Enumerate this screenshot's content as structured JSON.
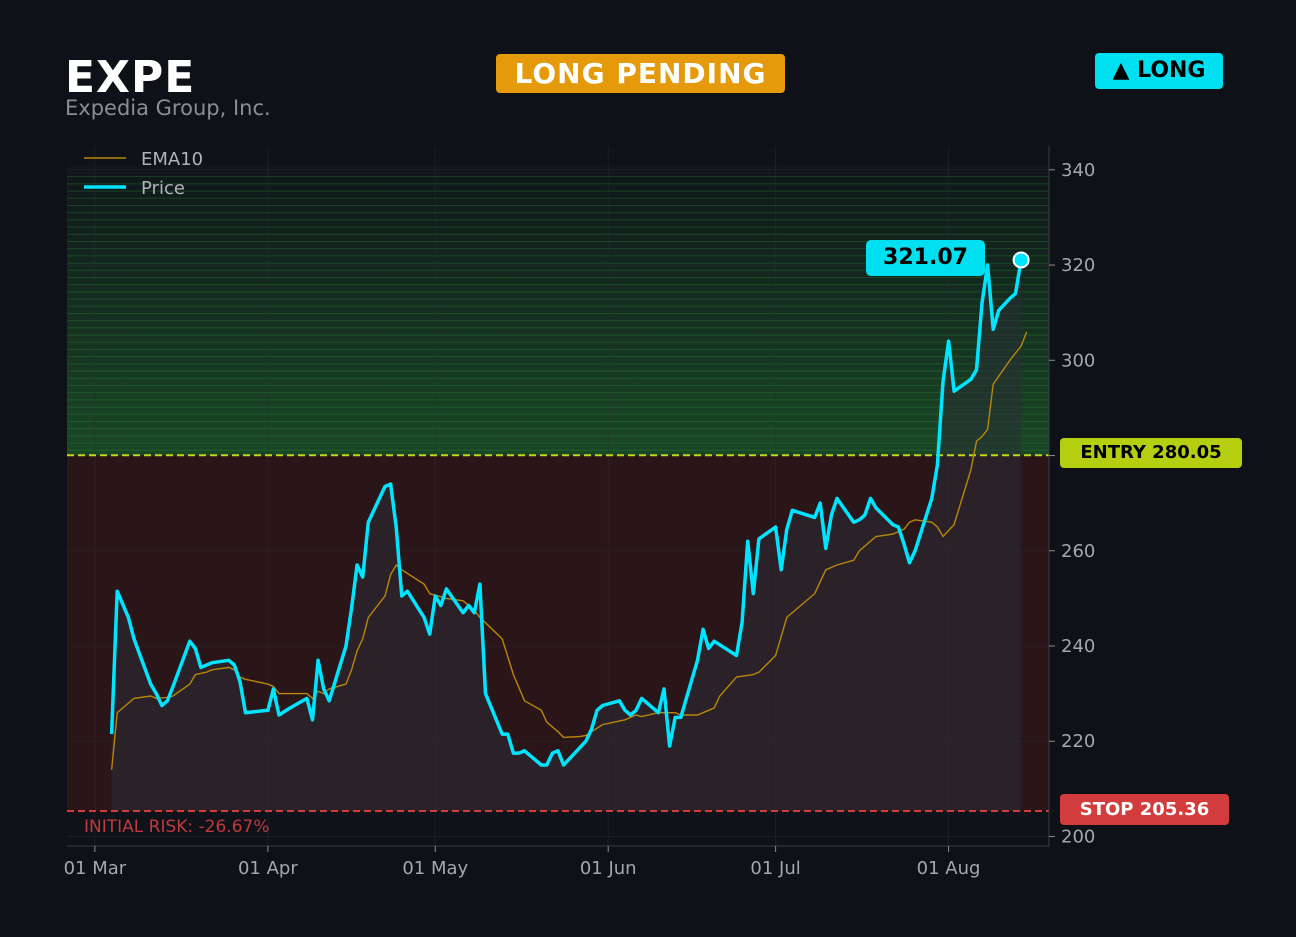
{
  "header": {
    "ticker": "EXPE",
    "company": "Expedia Group, Inc.",
    "status": "LONG PENDING",
    "direction": "▲ LONG"
  },
  "colors": {
    "background": "#0e1118",
    "price": "#00e5ff",
    "ema": "#b8860b",
    "entry": "#c4d61a",
    "stop": "#d23c3c",
    "status_badge": "#e59a0b",
    "profit_zone": "#1d5a2a",
    "risk_zone": "#2a1519"
  },
  "labels": {
    "last_price": "321.07",
    "entry": "ENTRY 280.05",
    "stop": "STOP 205.36",
    "initial_risk": "INITIAL RISK: -26.67%"
  },
  "chart_data": {
    "type": "line",
    "ylim": [
      198,
      345
    ],
    "yticks": [
      200,
      220,
      240,
      260,
      280,
      300,
      320,
      340
    ],
    "xticks": [
      {
        "date": "2024-03-01",
        "label": "01 Mar"
      },
      {
        "date": "2024-04-01",
        "label": "01 Apr"
      },
      {
        "date": "2024-05-01",
        "label": "01 May"
      },
      {
        "date": "2024-06-01",
        "label": "01 Jun"
      },
      {
        "date": "2024-07-01",
        "label": "01 Jul"
      },
      {
        "date": "2024-08-01",
        "label": "01 Aug"
      }
    ],
    "xlim": [
      "2024-02-25",
      "2024-08-19"
    ],
    "entry": 280.05,
    "stop": 205.36,
    "last_price": 321.07,
    "legend_position": "top-left",
    "grid": true,
    "series": [
      {
        "name": "EMA10",
        "points": [
          [
            "2024-03-04",
            214.0
          ],
          [
            "2024-03-05",
            226.0
          ],
          [
            "2024-03-07",
            228.0
          ],
          [
            "2024-03-08",
            229.0
          ],
          [
            "2024-03-11",
            229.5
          ],
          [
            "2024-03-12",
            229.0
          ],
          [
            "2024-03-14",
            229.2
          ],
          [
            "2024-03-15",
            229.5
          ],
          [
            "2024-03-18",
            232.0
          ],
          [
            "2024-03-19",
            234.0
          ],
          [
            "2024-03-21",
            234.5
          ],
          [
            "2024-03-22",
            235.0
          ],
          [
            "2024-03-25",
            235.5
          ],
          [
            "2024-03-26",
            235.0
          ],
          [
            "2024-03-27",
            233.5
          ],
          [
            "2024-03-28",
            233.0
          ],
          [
            "2024-04-01",
            232.0
          ],
          [
            "2024-04-02",
            231.5
          ],
          [
            "2024-04-03",
            230.0
          ],
          [
            "2024-04-08",
            230.0
          ],
          [
            "2024-04-09",
            229.0
          ],
          [
            "2024-04-10",
            230.5
          ],
          [
            "2024-04-11",
            230.0
          ],
          [
            "2024-04-12",
            231.0
          ],
          [
            "2024-04-15",
            232.0
          ],
          [
            "2024-04-16",
            235.0
          ],
          [
            "2024-04-17",
            239.0
          ],
          [
            "2024-04-18",
            241.5
          ],
          [
            "2024-04-19",
            246.0
          ],
          [
            "2024-04-22",
            250.5
          ],
          [
            "2024-04-23",
            255.0
          ],
          [
            "2024-04-24",
            257.0
          ],
          [
            "2024-04-25",
            256.0
          ],
          [
            "2024-04-29",
            253.0
          ],
          [
            "2024-04-30",
            251.0
          ],
          [
            "2024-05-03",
            250.0
          ],
          [
            "2024-05-06",
            249.5
          ],
          [
            "2024-05-07",
            248.5
          ],
          [
            "2024-05-08",
            247.5
          ],
          [
            "2024-05-09",
            246.0
          ],
          [
            "2024-05-13",
            241.5
          ],
          [
            "2024-05-15",
            234.0
          ],
          [
            "2024-05-17",
            228.5
          ],
          [
            "2024-05-20",
            226.5
          ],
          [
            "2024-05-21",
            224.0
          ],
          [
            "2024-05-23",
            222.0
          ],
          [
            "2024-05-24",
            220.8
          ],
          [
            "2024-05-27",
            221.0
          ],
          [
            "2024-05-28",
            221.2
          ],
          [
            "2024-05-29",
            222.0
          ],
          [
            "2024-05-31",
            223.5
          ],
          [
            "2024-06-04",
            224.5
          ],
          [
            "2024-06-05",
            225.0
          ],
          [
            "2024-06-06",
            225.5
          ],
          [
            "2024-06-07",
            225.2
          ],
          [
            "2024-06-10",
            226.0
          ],
          [
            "2024-06-13",
            226.0
          ],
          [
            "2024-06-14",
            225.5
          ],
          [
            "2024-06-17",
            225.5
          ],
          [
            "2024-06-18",
            226.0
          ],
          [
            "2024-06-20",
            227.0
          ],
          [
            "2024-06-21",
            229.5
          ],
          [
            "2024-06-24",
            233.5
          ],
          [
            "2024-06-27",
            234.0
          ],
          [
            "2024-06-28",
            234.5
          ],
          [
            "2024-07-01",
            238.0
          ],
          [
            "2024-07-02",
            242.0
          ],
          [
            "2024-07-03",
            246.0
          ],
          [
            "2024-07-05",
            248.0
          ],
          [
            "2024-07-08",
            251.0
          ],
          [
            "2024-07-10",
            256.0
          ],
          [
            "2024-07-12",
            257.0
          ],
          [
            "2024-07-15",
            258.0
          ],
          [
            "2024-07-16",
            260.0
          ],
          [
            "2024-07-18",
            262.0
          ],
          [
            "2024-07-19",
            263.0
          ],
          [
            "2024-07-22",
            263.5
          ],
          [
            "2024-07-24",
            264.5
          ],
          [
            "2024-07-25",
            266.0
          ],
          [
            "2024-07-26",
            266.5
          ],
          [
            "2024-07-29",
            266.0
          ],
          [
            "2024-07-30",
            265.0
          ],
          [
            "2024-07-31",
            263.0
          ],
          [
            "2024-08-02",
            265.5
          ],
          [
            "2024-08-05",
            277.0
          ],
          [
            "2024-08-06",
            283.0
          ],
          [
            "2024-08-07",
            284.0
          ],
          [
            "2024-08-08",
            285.5
          ],
          [
            "2024-08-09",
            295.0
          ],
          [
            "2024-08-12",
            300.0
          ],
          [
            "2024-08-13",
            301.5
          ],
          [
            "2024-08-14",
            303.0
          ],
          [
            "2024-08-15",
            306.0
          ]
        ]
      },
      {
        "name": "Price",
        "points": [
          [
            "2024-03-04",
            221.5
          ],
          [
            "2024-03-05",
            251.5
          ],
          [
            "2024-03-07",
            246.0
          ],
          [
            "2024-03-08",
            241.5
          ],
          [
            "2024-03-11",
            232.0
          ],
          [
            "2024-03-12",
            230.0
          ],
          [
            "2024-03-13",
            227.5
          ],
          [
            "2024-03-14",
            228.5
          ],
          [
            "2024-03-15",
            231.5
          ],
          [
            "2024-03-18",
            241.0
          ],
          [
            "2024-03-19",
            239.5
          ],
          [
            "2024-03-20",
            235.5
          ],
          [
            "2024-03-22",
            236.5
          ],
          [
            "2024-03-25",
            237.0
          ],
          [
            "2024-03-26",
            236.0
          ],
          [
            "2024-03-27",
            232.5
          ],
          [
            "2024-03-28",
            226.0
          ],
          [
            "2024-04-01",
            226.5
          ],
          [
            "2024-04-02",
            231.0
          ],
          [
            "2024-04-03",
            225.5
          ],
          [
            "2024-04-05",
            227.0
          ],
          [
            "2024-04-08",
            229.0
          ],
          [
            "2024-04-09",
            224.5
          ],
          [
            "2024-04-10",
            237.0
          ],
          [
            "2024-04-11",
            231.0
          ],
          [
            "2024-04-12",
            228.5
          ],
          [
            "2024-04-15",
            240.0
          ],
          [
            "2024-04-16",
            248.0
          ],
          [
            "2024-04-17",
            257.0
          ],
          [
            "2024-04-18",
            254.5
          ],
          [
            "2024-04-19",
            266.0
          ],
          [
            "2024-04-22",
            273.5
          ],
          [
            "2024-04-23",
            274.0
          ],
          [
            "2024-04-24",
            265.0
          ],
          [
            "2024-04-25",
            250.5
          ],
          [
            "2024-04-26",
            251.5
          ],
          [
            "2024-04-29",
            246.0
          ],
          [
            "2024-04-30",
            242.5
          ],
          [
            "2024-05-01",
            250.5
          ],
          [
            "2024-05-02",
            248.5
          ],
          [
            "2024-05-03",
            252.0
          ],
          [
            "2024-05-06",
            247.0
          ],
          [
            "2024-05-07",
            248.5
          ],
          [
            "2024-05-08",
            247.0
          ],
          [
            "2024-05-09",
            253.0
          ],
          [
            "2024-05-10",
            230.0
          ],
          [
            "2024-05-13",
            221.5
          ],
          [
            "2024-05-14",
            221.5
          ],
          [
            "2024-05-15",
            217.5
          ],
          [
            "2024-05-16",
            217.5
          ],
          [
            "2024-05-17",
            218.0
          ],
          [
            "2024-05-20",
            215.0
          ],
          [
            "2024-05-21",
            215.0
          ],
          [
            "2024-05-22",
            217.5
          ],
          [
            "2024-05-23",
            218.0
          ],
          [
            "2024-05-24",
            215.0
          ],
          [
            "2024-05-28",
            220.0
          ],
          [
            "2024-05-29",
            222.5
          ],
          [
            "2024-05-30",
            226.5
          ],
          [
            "2024-05-31",
            227.5
          ],
          [
            "2024-06-03",
            228.5
          ],
          [
            "2024-06-04",
            226.5
          ],
          [
            "2024-06-05",
            225.5
          ],
          [
            "2024-06-06",
            226.5
          ],
          [
            "2024-06-07",
            229.0
          ],
          [
            "2024-06-10",
            226.0
          ],
          [
            "2024-06-11",
            231.0
          ],
          [
            "2024-06-12",
            219.0
          ],
          [
            "2024-06-13",
            225.0
          ],
          [
            "2024-06-14",
            225.0
          ],
          [
            "2024-06-17",
            237.0
          ],
          [
            "2024-06-18",
            243.5
          ],
          [
            "2024-06-19",
            239.5
          ],
          [
            "2024-06-20",
            241.0
          ],
          [
            "2024-06-24",
            238.0
          ],
          [
            "2024-06-25",
            245.0
          ],
          [
            "2024-06-26",
            262.0
          ],
          [
            "2024-06-27",
            251.0
          ],
          [
            "2024-06-28",
            262.5
          ],
          [
            "2024-07-01",
            265.0
          ],
          [
            "2024-07-02",
            256.0
          ],
          [
            "2024-07-03",
            264.5
          ],
          [
            "2024-07-04",
            268.5
          ],
          [
            "2024-07-08",
            267.0
          ],
          [
            "2024-07-09",
            270.0
          ],
          [
            "2024-07-10",
            260.5
          ],
          [
            "2024-07-11",
            267.5
          ],
          [
            "2024-07-12",
            271.0
          ],
          [
            "2024-07-15",
            266.0
          ],
          [
            "2024-07-16",
            266.5
          ],
          [
            "2024-07-17",
            267.5
          ],
          [
            "2024-07-18",
            271.0
          ],
          [
            "2024-07-19",
            269.0
          ],
          [
            "2024-07-22",
            265.5
          ],
          [
            "2024-07-23",
            265.0
          ],
          [
            "2024-07-24",
            261.5
          ],
          [
            "2024-07-25",
            257.5
          ],
          [
            "2024-07-26",
            260.0
          ],
          [
            "2024-07-29",
            271.0
          ],
          [
            "2024-07-30",
            278.0
          ],
          [
            "2024-07-31",
            295.5
          ],
          [
            "2024-08-01",
            304.0
          ],
          [
            "2024-08-02",
            293.5
          ],
          [
            "2024-08-05",
            296.0
          ],
          [
            "2024-08-06",
            298.0
          ],
          [
            "2024-08-07",
            312.0
          ],
          [
            "2024-08-08",
            320.0
          ],
          [
            "2024-08-09",
            306.5
          ],
          [
            "2024-08-10",
            310.5
          ],
          [
            "2024-08-12",
            313.0
          ],
          [
            "2024-08-13",
            314.0
          ],
          [
            "2024-08-14",
            321.07
          ]
        ]
      }
    ]
  }
}
